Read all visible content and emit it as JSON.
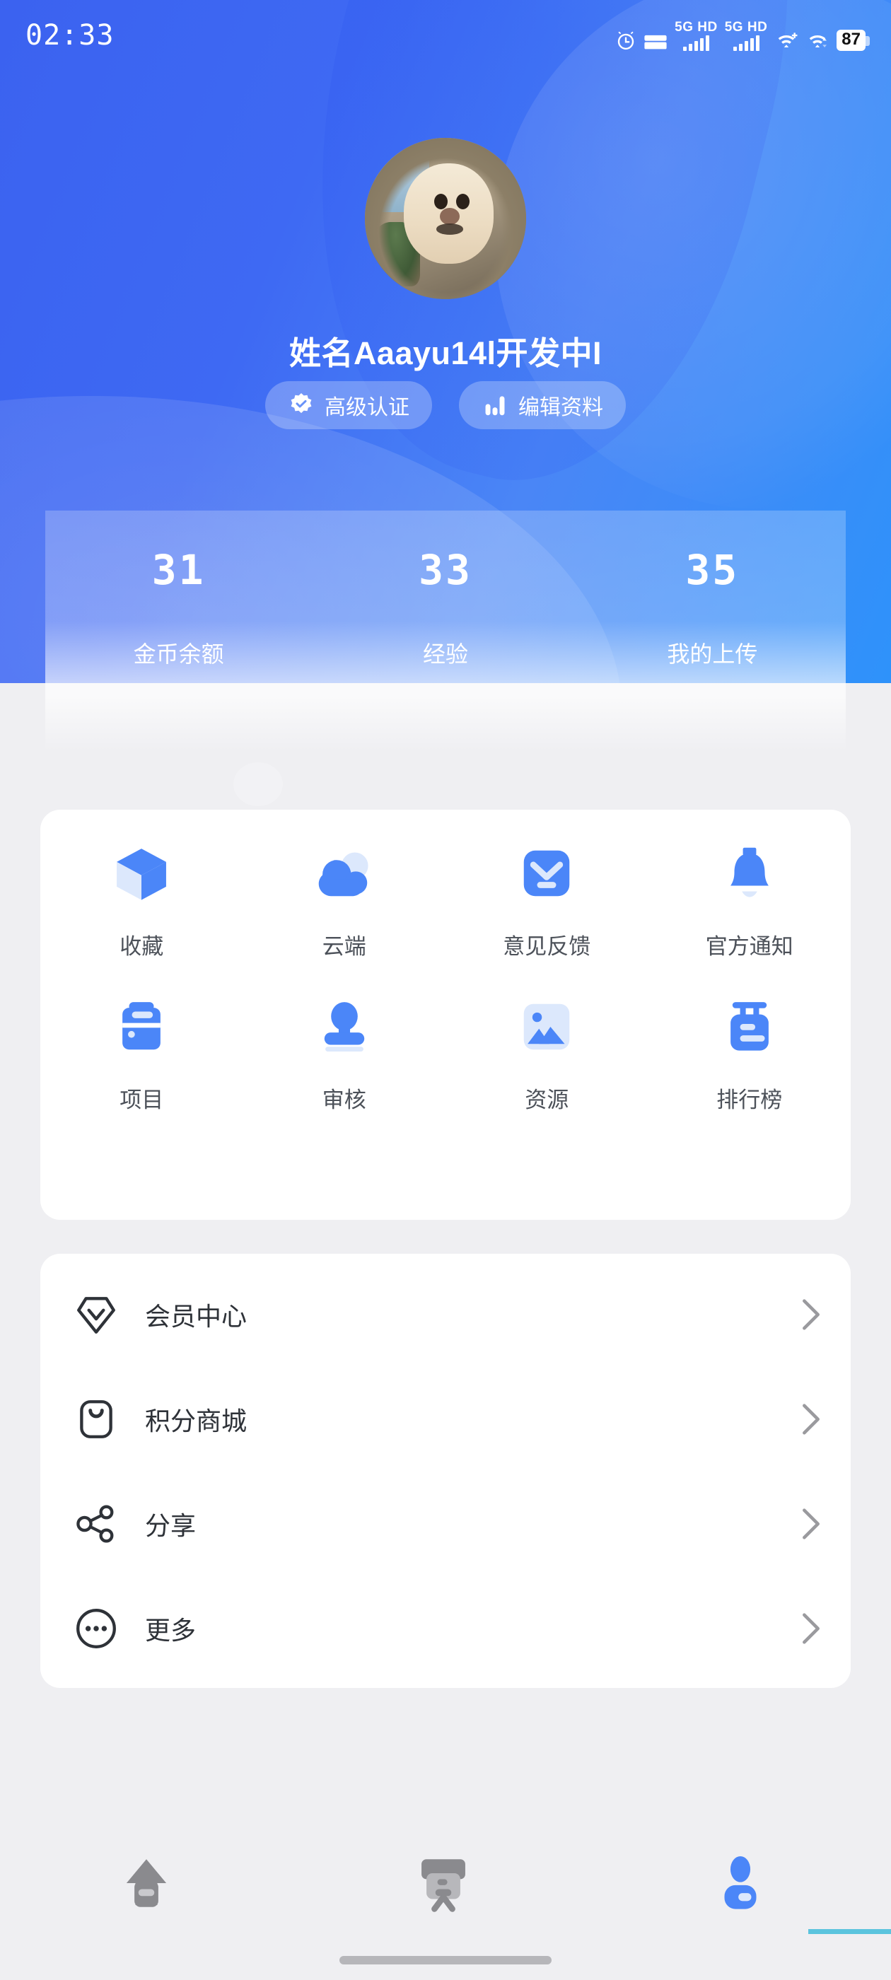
{
  "status_bar": {
    "time": "02:33",
    "alarm_icon": "alarm-clock-icon",
    "bed_icon": "bed-icon",
    "sim1_label": "5G HD",
    "sim2_label": "5G HD",
    "wifi1_icon": "wifi-plus-icon",
    "wifi2_icon": "wifi-transfer-icon",
    "battery_level": "87"
  },
  "profile": {
    "avatar_alt": "dog-avatar",
    "username": "姓名Aaayu14l开发中I",
    "badges": [
      {
        "label": "高级认证",
        "icon": "verified-badge-icon"
      },
      {
        "label": "编辑资料",
        "icon": "bar-chart-icon"
      }
    ]
  },
  "stats": [
    {
      "value": "31",
      "label": "金币余额"
    },
    {
      "value": "33",
      "label": "经验"
    },
    {
      "value": "35",
      "label": "我的上传"
    }
  ],
  "grid": [
    {
      "label": "收藏",
      "icon": "cube-icon"
    },
    {
      "label": "云端",
      "icon": "cloud-icon"
    },
    {
      "label": "意见反馈",
      "icon": "feedback-envelope-icon"
    },
    {
      "label": "官方通知",
      "icon": "bell-icon"
    },
    {
      "label": "项目",
      "icon": "toolbox-icon"
    },
    {
      "label": "审核",
      "icon": "stamp-icon"
    },
    {
      "label": "资源",
      "icon": "image-icon"
    },
    {
      "label": "排行榜",
      "icon": "leaderboard-board-icon"
    }
  ],
  "menu": [
    {
      "label": "会员中心",
      "icon": "vip-diamond-icon",
      "chevron": "chevron-right-icon"
    },
    {
      "label": "积分商城",
      "icon": "shopping-bag-icon",
      "chevron": "chevron-right-icon"
    },
    {
      "label": "分享",
      "icon": "share-nodes-icon",
      "chevron": "chevron-right-icon"
    },
    {
      "label": "更多",
      "icon": "more-ellipsis-icon",
      "chevron": "chevron-right-icon"
    }
  ],
  "tabbar": [
    {
      "label": "home",
      "icon": "home-icon",
      "active": false
    },
    {
      "label": "board",
      "icon": "presentation-icon",
      "active": false
    },
    {
      "label": "profile",
      "icon": "person-icon",
      "active": true
    }
  ],
  "colors": {
    "brand_blue": "#3B62F0",
    "accent_blue": "#4B86F8",
    "page_bg": "#EFEFF2",
    "card_bg": "#FFFFFF",
    "label_gray": "#4C5159",
    "menu_text": "#2E3238",
    "chevron_gray": "#9A9A9E",
    "tab_inactive": "#8A8A8E",
    "edge_line": "#5BC4DE",
    "battery_text": "#111111"
  }
}
